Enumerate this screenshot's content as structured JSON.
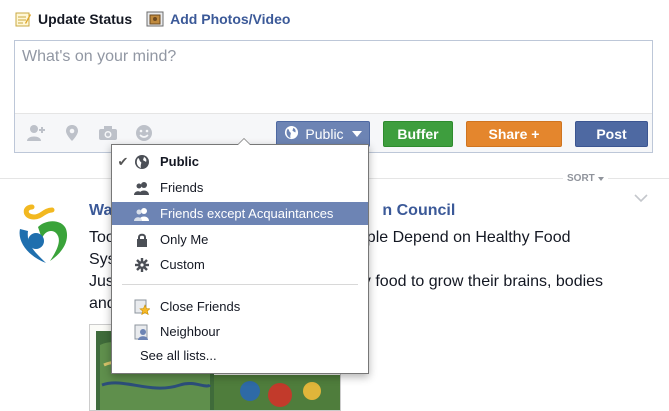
{
  "tabs": {
    "status": "Update Status",
    "photos": "Add Photos/Video"
  },
  "composer": {
    "placeholder": "What's on your mind?"
  },
  "buttons": {
    "audience": "Public",
    "buffer": "Buffer",
    "share": "Share +",
    "post": "Post"
  },
  "colors": {
    "audience": "#6d84b4",
    "buffer": "#3e9e3e",
    "share": "#e4862d",
    "post": "#4e69a2",
    "link": "#3b5998"
  },
  "feed": {
    "sort_label": "SORT"
  },
  "story": {
    "title_visible": "Wa",
    "title_tail": "n Council",
    "line1_a": "Too",
    "line1_b": "ple Depend on Healthy Food",
    "line2": "Sys",
    "line3_a": "Jus",
    "line3_b": "y food to grow their brains, bodies",
    "line4": "and"
  },
  "audience_menu": {
    "items": [
      {
        "label": "Public",
        "icon": "globe-icon",
        "checked": true
      },
      {
        "label": "Friends",
        "icon": "friends-icon"
      },
      {
        "label": "Friends except Acquaintances",
        "icon": "friends-except-icon",
        "highlighted": true
      },
      {
        "label": "Only Me",
        "icon": "lock-icon"
      },
      {
        "label": "Custom",
        "icon": "gear-icon"
      },
      {
        "label": "Close Friends",
        "icon": "star-list-icon"
      },
      {
        "label": "Neighbour",
        "icon": "list-icon"
      },
      {
        "label": "See all lists...",
        "icon": ""
      }
    ]
  }
}
